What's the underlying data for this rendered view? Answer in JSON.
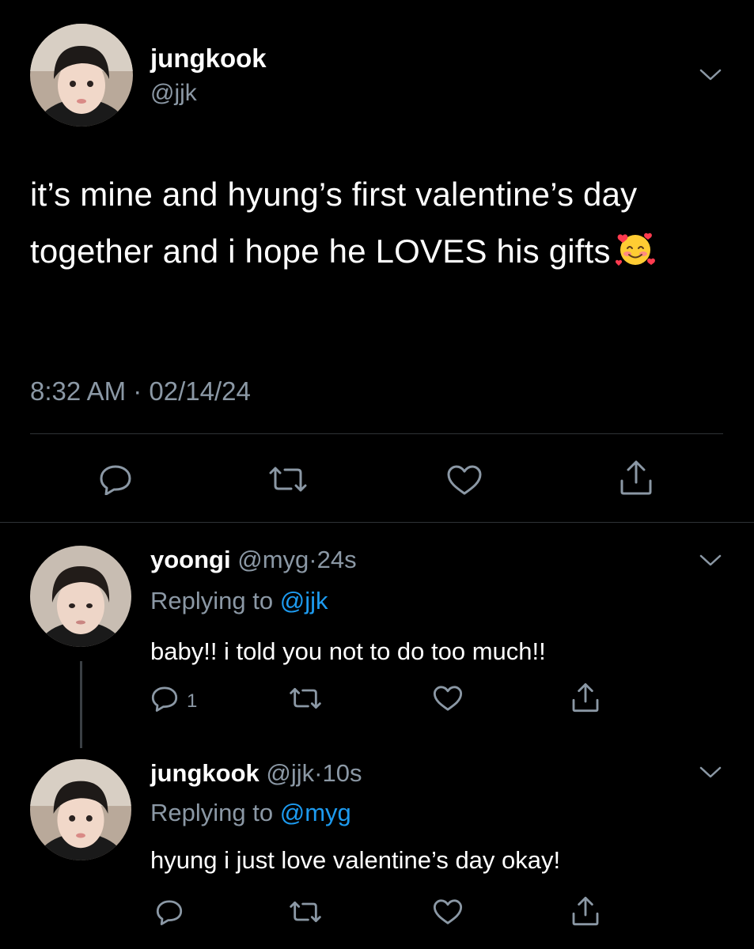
{
  "main_tweet": {
    "display_name": "jungkook",
    "handle": "@jjk",
    "text": "it’s mine and hyung’s first valentine’s day together and i hope he LOVES his gifts",
    "emoji": "smiling-face-with-hearts-icon",
    "timestamp": "8:32 AM · 02/14/24"
  },
  "replies": [
    {
      "display_name": "yoongi",
      "handle": "@myg",
      "separator": "·",
      "time": "24s",
      "replying_prefix": "Replying to",
      "replying_to": "@jjk",
      "text": "baby!! i told you not to do too much!!",
      "reply_count": "1"
    },
    {
      "display_name": "jungkook",
      "handle": "@jjk",
      "separator": "·",
      "time": "10s",
      "replying_prefix": "Replying to",
      "replying_to": "@myg",
      "text": "hyung i just love valentine’s day okay!"
    }
  ],
  "colors": {
    "background": "#000000",
    "text": "#ffffff",
    "muted": "#8b98a5",
    "link": "#1d9bf0",
    "divider": "#2f3336"
  },
  "icons": [
    "chevron-down-icon",
    "reply-icon",
    "retweet-icon",
    "like-icon",
    "share-icon"
  ]
}
